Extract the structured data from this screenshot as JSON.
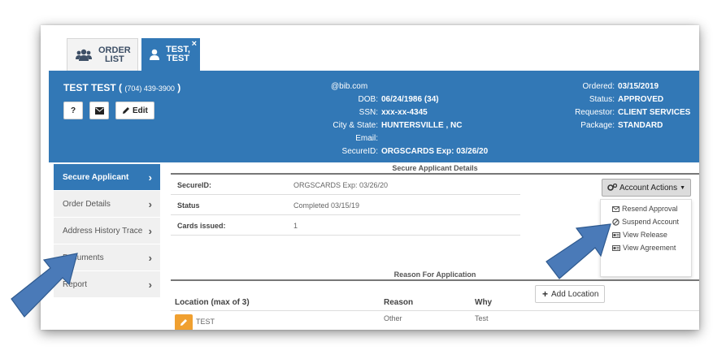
{
  "tabs": [
    {
      "line1": "ORDER",
      "line2": "LIST",
      "icon": "users-icon"
    },
    {
      "line1": "TEST,",
      "line2": "TEST",
      "icon": "user-icon",
      "close": "×"
    }
  ],
  "header": {
    "applicant_name": "TEST TEST (",
    "phone": "(704) 439-3900",
    "name_close": ")",
    "help_label": "?",
    "edit_label": "Edit",
    "email_top": "@bib.com",
    "center_fields": [
      {
        "label": "DOB:",
        "value": "06/24/1986 (34)"
      },
      {
        "label": "SSN:",
        "value": "xxx-xx-4345"
      },
      {
        "label": "City & State:",
        "value": "HUNTERSVILLE , NC"
      },
      {
        "label": "Email:",
        "value": ""
      },
      {
        "label": "SecureID:",
        "value": "ORGSCARDS Exp: 03/26/20"
      }
    ],
    "right_fields": [
      {
        "label": "Ordered:",
        "value": "03/15/2019"
      },
      {
        "label": "Status:",
        "value": "APPROVED"
      },
      {
        "label": "Requestor:",
        "value": "CLIENT SERVICES"
      },
      {
        "label": "Package:",
        "value": "STANDARD"
      }
    ]
  },
  "sidebar": {
    "items": [
      {
        "label": "Secure Applicant",
        "active": true
      },
      {
        "label": "Order Details"
      },
      {
        "label": "Address History Trace"
      },
      {
        "label": "Documents"
      },
      {
        "label": "Report"
      }
    ]
  },
  "details": {
    "title": "Secure Applicant Details",
    "rows": [
      {
        "label": "SecureID:",
        "value": "ORGSCARDS Exp: 03/26/20"
      },
      {
        "label": "Status",
        "value": "Completed 03/15/19"
      },
      {
        "label": "Cards issued:",
        "value": "1"
      }
    ]
  },
  "account_actions": {
    "label": "Account Actions",
    "items": [
      {
        "label": "Resend Approval",
        "icon": "envelope-icon"
      },
      {
        "label": "Suspend Account",
        "icon": "ban-icon"
      },
      {
        "label": "View Release",
        "icon": "id-card-icon"
      },
      {
        "label": "View Agreement",
        "icon": "id-card-icon"
      }
    ]
  },
  "reason": {
    "title": "Reason For Application",
    "add_location_label": "Add Location",
    "columns": [
      "Location (max of 3)",
      "Reason",
      "Why"
    ],
    "rows": [
      {
        "location": "TEST",
        "reason": "Other",
        "why": "Test"
      }
    ]
  },
  "colors": {
    "primary": "#3278b6",
    "edit_orange": "#f0a030"
  }
}
